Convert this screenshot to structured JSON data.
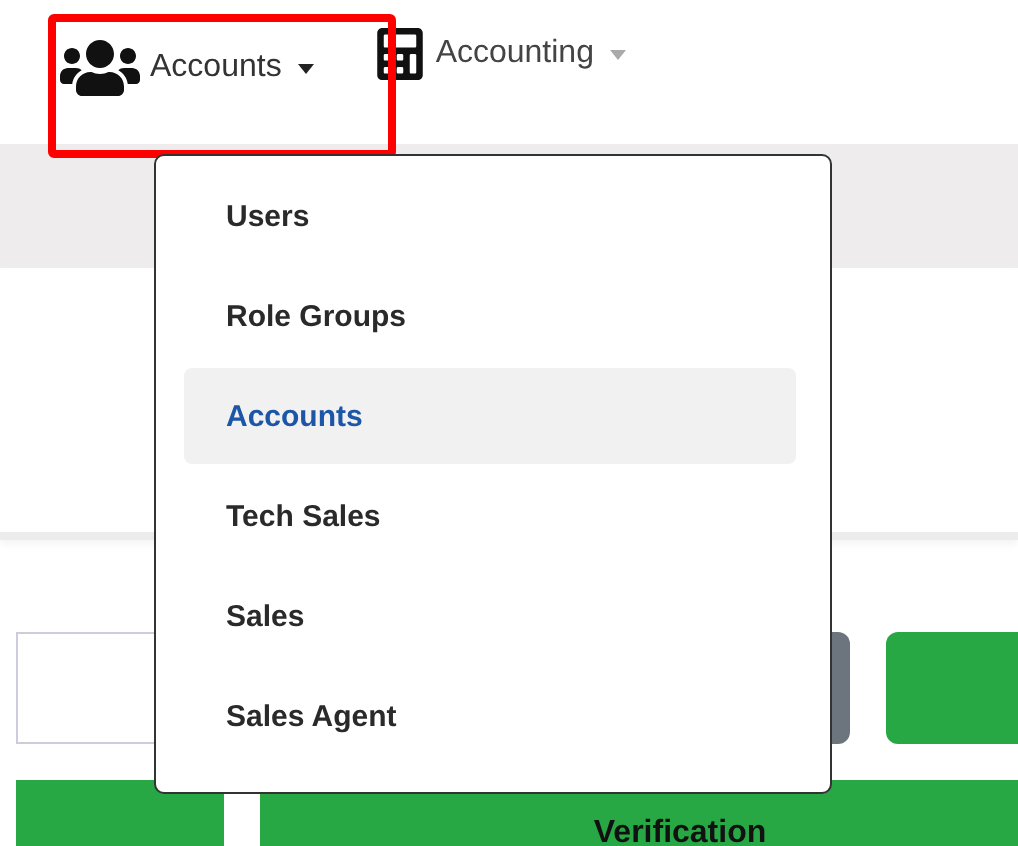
{
  "nav": [
    {
      "label": "Accounts",
      "highlighted": true,
      "expanded": true
    },
    {
      "label": "Accounting",
      "highlighted": false,
      "expanded": false
    }
  ],
  "dropdown": {
    "items": [
      {
        "label": "Users",
        "selected": false
      },
      {
        "label": "Role Groups",
        "selected": false
      },
      {
        "label": "Accounts",
        "selected": true
      },
      {
        "label": "Tech Sales",
        "selected": false
      },
      {
        "label": "Sales",
        "selected": false
      },
      {
        "label": "Sales Agent",
        "selected": false
      }
    ]
  },
  "table": {
    "columns": [
      {
        "kind": "blank"
      },
      {
        "kind": "text",
        "label": "Verification"
      }
    ]
  }
}
